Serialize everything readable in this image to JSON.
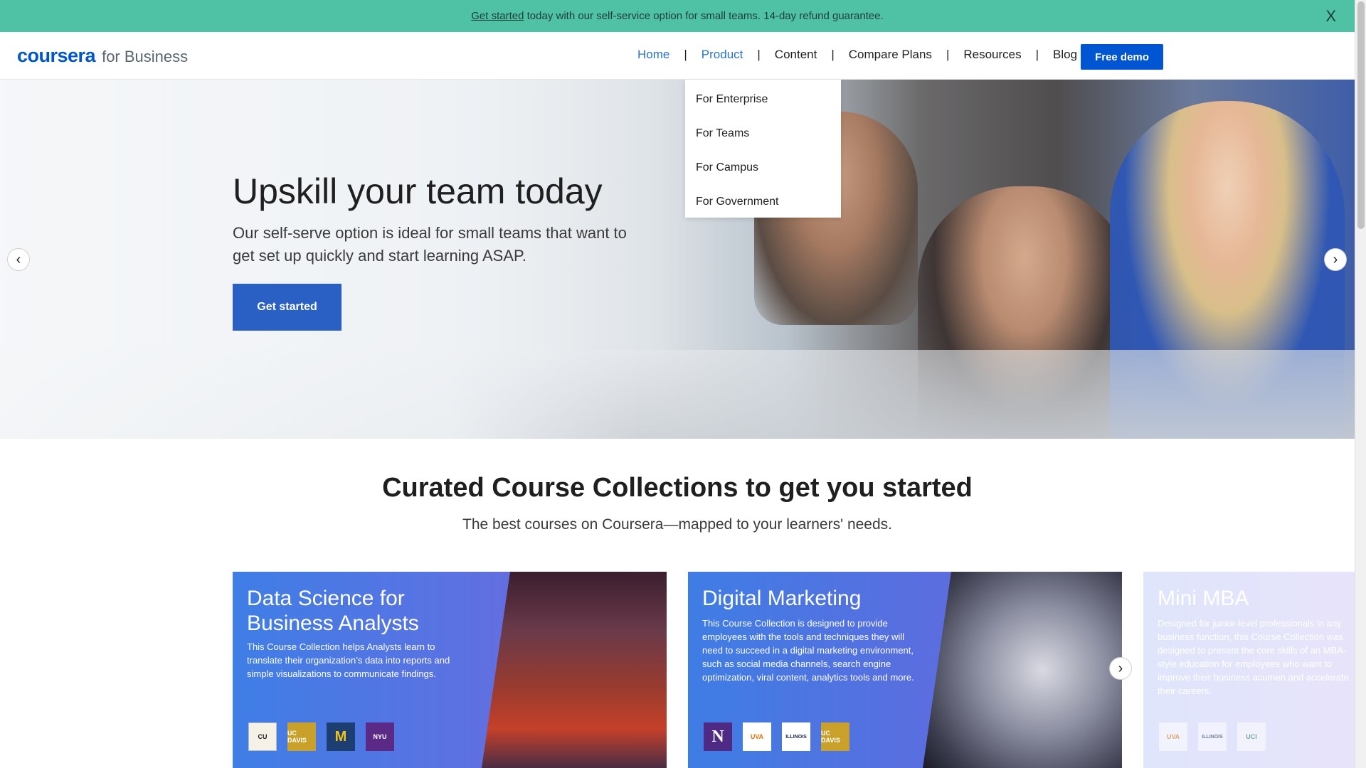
{
  "banner": {
    "link_text": "Get started",
    "text": " today with our self-service option for small teams. 14-day refund guarantee.",
    "close_label": "X"
  },
  "header": {
    "logo_brand": "coursera",
    "logo_sub": "for Business",
    "nav": {
      "home": "Home",
      "product": "Product",
      "content": "Content",
      "compare": "Compare Plans",
      "resources": "Resources",
      "blog": "Blog",
      "separator": "|"
    },
    "demo_button": "Free demo"
  },
  "dropdown": {
    "items": [
      "For Enterprise",
      "For Teams",
      "For Campus",
      "For Government"
    ]
  },
  "hero": {
    "title": "Upskill your team today",
    "subtitle": "Our self-serve option is ideal for small teams that want to get set up quickly and start learning ASAP.",
    "cta": "Get started",
    "prev_arrow": "‹",
    "next_arrow": "›"
  },
  "collections": {
    "title": "Curated Course Collections to get you started",
    "subtitle": "The best courses on Coursera—mapped to your learners' needs.",
    "next_arrow": "›",
    "cards": [
      {
        "title": "Data Science for Business Analysts",
        "description": "This Course Collection helps Analysts learn to translate their organization’s data into reports and simple visualizations to communicate findings.",
        "logos": [
          "CU",
          "UC DAVIS",
          "M",
          "NYU"
        ]
      },
      {
        "title": "Digital Marketing",
        "description": "This Course Collection is designed to provide employees with the tools and techniques they will need to succeed in a digital marketing environment, such as social media channels, search engine optimization, viral content, analytics tools and more.",
        "logos": [
          "N",
          "UVA",
          "ILLINOIS",
          "UC DAVIS"
        ]
      },
      {
        "title": "Mini MBA",
        "description": "Designed for junior-level professionals in any business function, this Course Collection was designed to present the core skills of an MBA-style education for employees who want to improve their business acumen and accelerate their careers.",
        "logos": [
          "UVA",
          "ILLINOIS",
          "UCI"
        ]
      }
    ]
  },
  "colors": {
    "banner": "#4fc2a6",
    "brand": "#0056d2",
    "cta": "#2a5fc4"
  }
}
